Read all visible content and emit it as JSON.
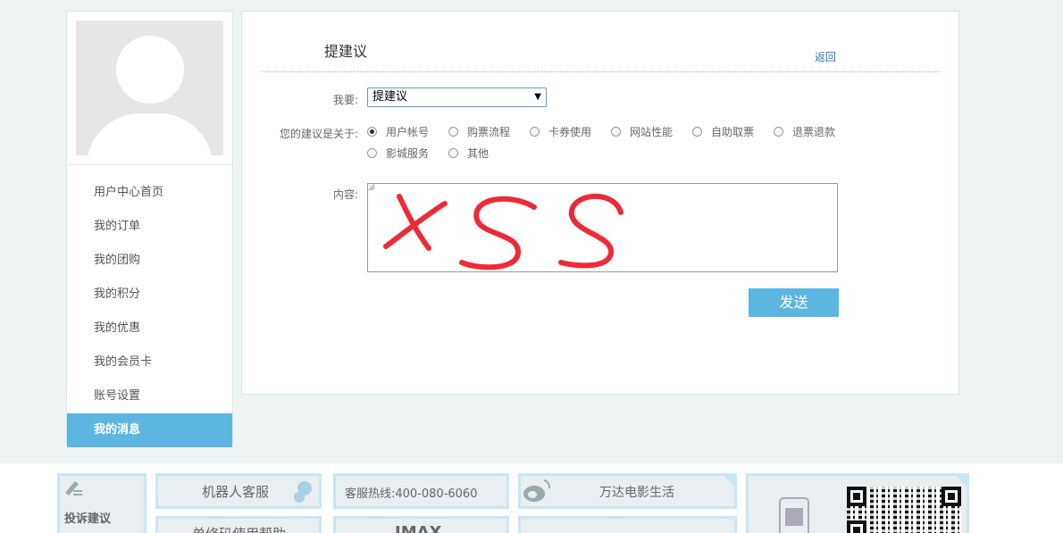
{
  "sidebar": {
    "items": [
      {
        "label": "用户中心首页"
      },
      {
        "label": "我的订单"
      },
      {
        "label": "我的团购"
      },
      {
        "label": "我的积分"
      },
      {
        "label": "我的优惠"
      },
      {
        "label": "我的会员卡"
      },
      {
        "label": "账号设置"
      },
      {
        "label": "我的消息"
      }
    ],
    "active_index": 7
  },
  "panel": {
    "title": "提建议",
    "back_label": "返回",
    "want_label": "我要:",
    "select_value": "提建议",
    "about_label": "您的建议是关于:",
    "topics": [
      "用户帐号",
      "购票流程",
      "卡券使用",
      "网站性能",
      "自助取票",
      "退票退款",
      "影城服务",
      "其他"
    ],
    "selected_topic": "用户帐号",
    "content_label": "内容:",
    "content_handwriting": "XSS",
    "send_label": "发送"
  },
  "footer": {
    "complaint": "投诉建议",
    "robot_service": "机器人客服",
    "hotline": "客服热线:400-080-6060",
    "wanda_life": "万达电影生活",
    "help": "单修码使用帮助",
    "imax": "IMAX"
  },
  "colors": {
    "accent": "#5cb6e0",
    "link": "#2a7cb8",
    "page_bg": "#eef3f3",
    "handwriting": "#ee2a36"
  }
}
